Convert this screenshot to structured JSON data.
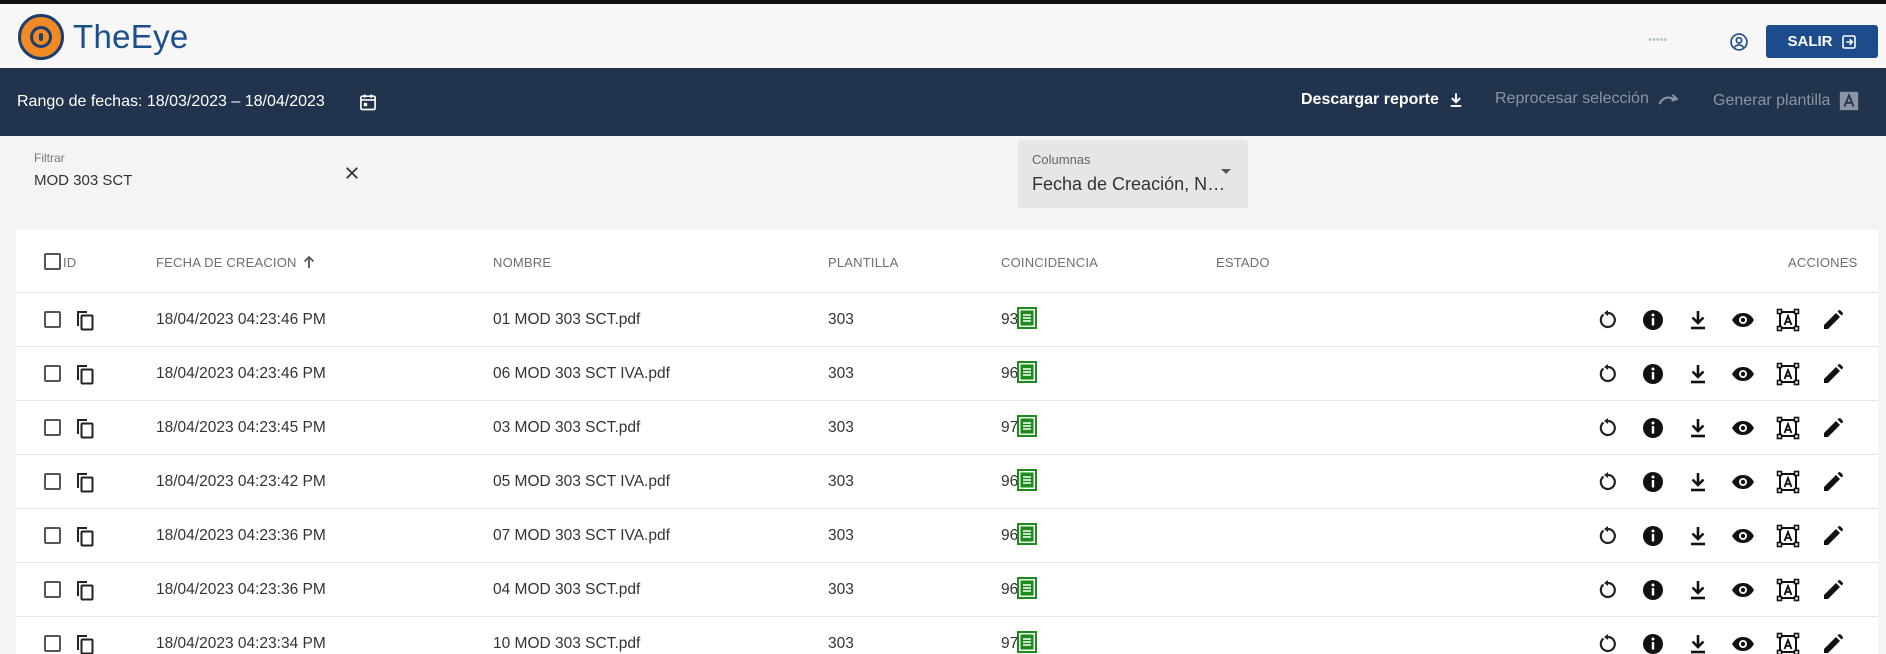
{
  "app": {
    "brand_name": "TheEye",
    "user_name": "•••••",
    "logout_label": "SALIR"
  },
  "toolbar": {
    "date_range": "Rango de fechas: 18/03/2023 – 18/04/2023",
    "download_report_label": "Descargar reporte",
    "reprocess_label": "Reprocesar selección",
    "generate_template_label": "Generar plantilla"
  },
  "filter": {
    "label": "Filtrar",
    "value": "MOD 303 SCT"
  },
  "columns_select": {
    "label": "Columnas",
    "value": "Fecha de Creación, N…"
  },
  "table": {
    "headers": {
      "id": "ID",
      "created": "FECHA DE CREACION",
      "name": "NOMBRE",
      "template": "PLANTILLA",
      "match": "COINCIDENCIA",
      "status": "ESTADO",
      "actions": "ACCIONES"
    },
    "sort": {
      "column": "created",
      "direction": "ascending"
    },
    "rows": [
      {
        "created": "18/04/2023 04:23:46 PM",
        "name": "01 MOD 303 SCT.pdf",
        "template": "303",
        "match": "93%"
      },
      {
        "created": "18/04/2023 04:23:46 PM",
        "name": "06 MOD 303 SCT IVA.pdf",
        "template": "303",
        "match": "96%"
      },
      {
        "created": "18/04/2023 04:23:45 PM",
        "name": "03 MOD 303 SCT.pdf",
        "template": "303",
        "match": "97%"
      },
      {
        "created": "18/04/2023 04:23:42 PM",
        "name": "05 MOD 303 SCT IVA.pdf",
        "template": "303",
        "match": "96%"
      },
      {
        "created": "18/04/2023 04:23:36 PM",
        "name": "07 MOD 303 SCT IVA.pdf",
        "template": "303",
        "match": "96%"
      },
      {
        "created": "18/04/2023 04:23:36 PM",
        "name": "04 MOD 303 SCT.pdf",
        "template": "303",
        "match": "96%"
      },
      {
        "created": "18/04/2023 04:23:34 PM",
        "name": "10 MOD 303 SCT.pdf",
        "template": "303",
        "match": "97%"
      }
    ],
    "row_actions": [
      "reprocess-icon",
      "info-icon",
      "download-icon",
      "view-icon",
      "template-icon",
      "edit-icon"
    ],
    "status_icon": "document-status-icon"
  },
  "colors": {
    "header_bar": "#22334e",
    "primary_button": "#1c4c8c",
    "brand_text": "#1d4e8c",
    "logo_orange": "#f08a24",
    "status_green": "#1e8a1e",
    "disabled_text": "#8a94a3"
  }
}
